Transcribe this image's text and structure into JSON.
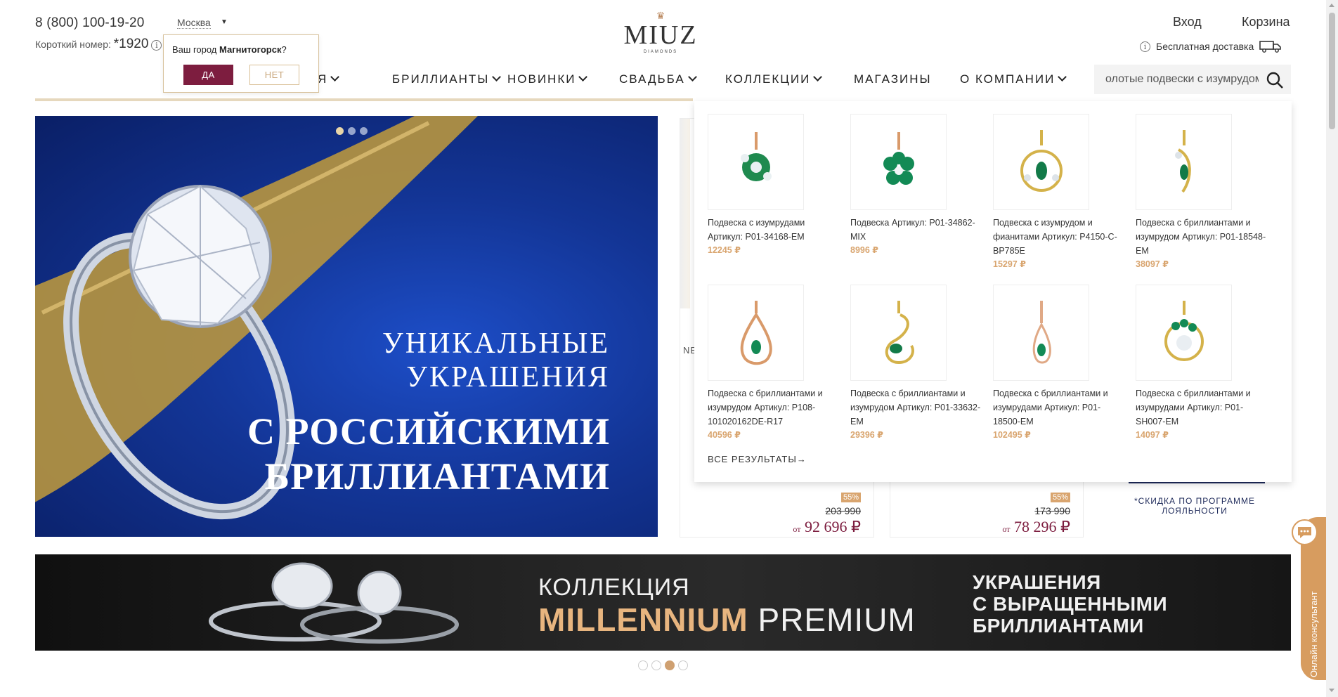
{
  "header": {
    "phone": "8 (800) 100-19-20",
    "short_label": "Короткий номер:",
    "short_number": "*1920",
    "city": "Москва",
    "login": "Вход",
    "cart": "Корзина",
    "delivery": "Бесплатная доставка"
  },
  "logo": {
    "name": "MIUZ",
    "sub": "DIAMONDS"
  },
  "city_popup": {
    "question_prefix": "Ваш город ",
    "city": "Магнитогорск",
    "question_suffix": "?",
    "yes": "ДА",
    "no": "НЕТ"
  },
  "nav": [
    {
      "label": "Я"
    },
    {
      "label": "БРИЛЛИАНТЫ"
    },
    {
      "label": "НОВИНКИ"
    },
    {
      "label": "СВАДЬБА"
    },
    {
      "label": "КОЛЛЕКЦИИ"
    },
    {
      "label": "МАГАЗИНЫ"
    },
    {
      "label": "О КОМПАНИИ"
    }
  ],
  "search": {
    "value": "олотые подвески с изумрудом"
  },
  "hero": {
    "line1": "УНИКАЛЬНЫЕ",
    "line2": "УКРАШЕНИЯ",
    "line3": "С РОССИЙСКИМИ",
    "line4": "БРИЛЛИАНТАМИ",
    "active_slide": 1,
    "slides": 3
  },
  "cards": [
    {
      "badge": "55%",
      "old": "203 990",
      "price_prefix": "от",
      "price": "92 696 ₽",
      "label": "NE"
    },
    {
      "badge": "55%",
      "old": "173 990",
      "price_prefix": "от",
      "price": "78 296 ₽"
    }
  ],
  "loyalty": "*СКИДКА ПО ПРОГРАММЕ ЛОЯЛЬНОСТИ",
  "dropdown": {
    "items": [
      {
        "title": "Подвеска с изумрудами Артикул: Р01-34168-ЕМ",
        "price": "12245 ₽",
        "icon": "pendant-flower-icon"
      },
      {
        "title": "Подвеска Артикул: Р01-34862-MIX",
        "price": "8996 ₽",
        "icon": "pendant-flower-icon"
      },
      {
        "title": "Подвеска с изумрудом и фианитами Артикул: Р4150-С-ВР785Е",
        "price": "15297 ₽",
        "icon": "pendant-oval-icon"
      },
      {
        "title": "Подвеска с бриллиантами и изумрудом Артикул: Р01-18548-ЕМ",
        "price": "38097 ₽",
        "icon": "pendant-leaf-icon"
      },
      {
        "title": "Подвеска с бриллиантами и изумрудом Артикул: Р108-101020162DE-R17",
        "price": "40596 ₽",
        "icon": "pendant-drop-icon"
      },
      {
        "title": "Подвеска с бриллиантами и изумрудом Артикул: Р01-33632-ЕМ",
        "price": "29396 ₽",
        "icon": "pendant-swan-icon"
      },
      {
        "title": "Подвеска с бриллиантами и изумрудами Артикул: Р01-18500-ЕМ",
        "price": "102495 ₽",
        "icon": "pendant-drop-icon"
      },
      {
        "title": "Подвеска с бриллиантами и изумрудами Артикул: Р01-SH007-ЕМ",
        "price": "14097 ₽",
        "icon": "pendant-swirl-icon"
      }
    ],
    "all_results": "ВСЕ РЕЗУЛЬТАТЫ→"
  },
  "banner2": {
    "line1": "КОЛЛЕКЦИЯ",
    "line2_bold": "MILLENNIUM",
    "line2_rest": " PREMIUM",
    "right1": "УКРАШЕНИЯ",
    "right2": "С ВЫРАЩЕННЫМИ",
    "right3": "БРИЛЛИАНТАМИ",
    "active_slide": 3,
    "slides": 4
  },
  "consultant": "Онлайн консультант",
  "colors": {
    "brand": "#7d1d3f",
    "gold": "#d9a56f",
    "hero_blue": "#133596"
  }
}
